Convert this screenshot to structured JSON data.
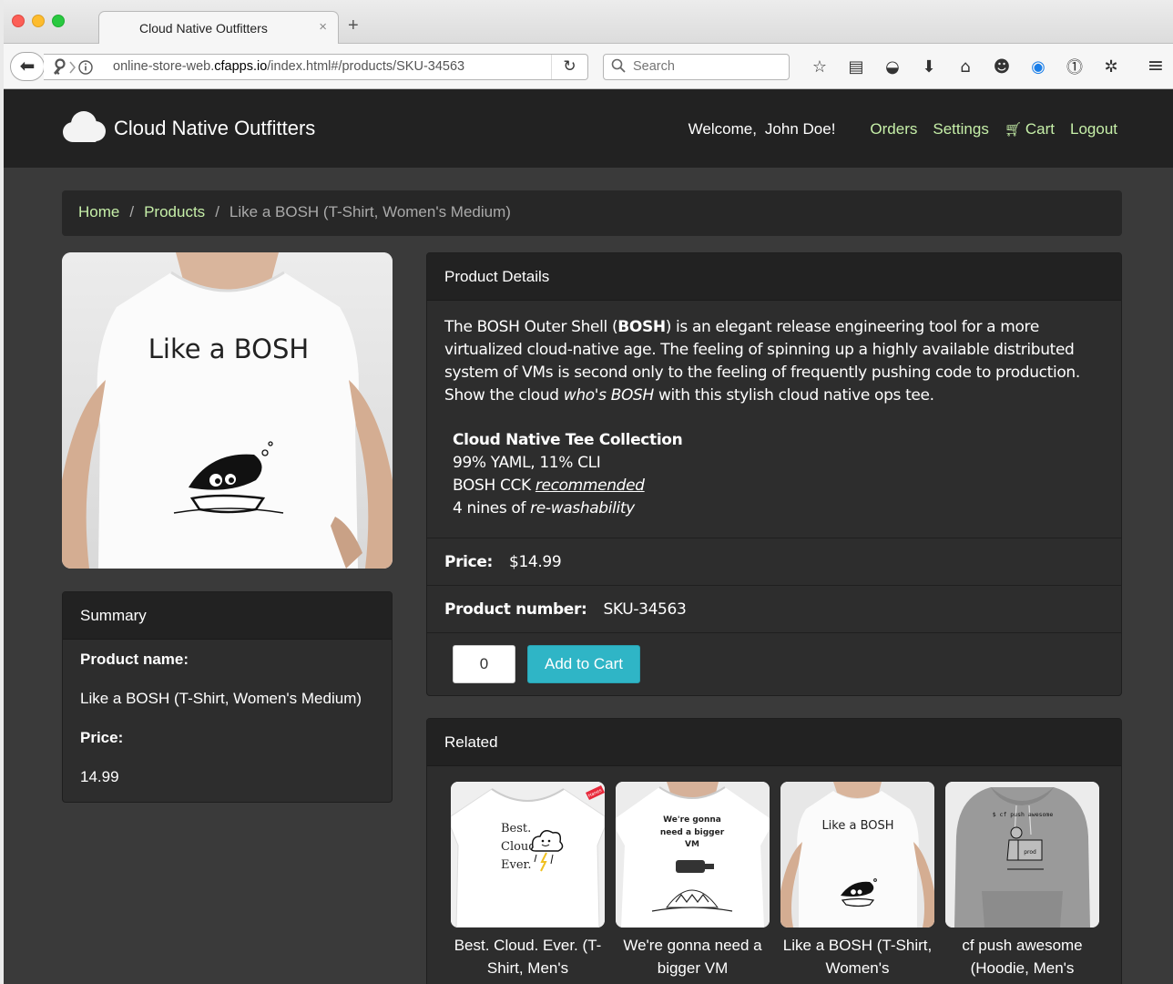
{
  "browser": {
    "tab_title": "Cloud Native Outfitters",
    "tab_close": "×",
    "new_tab": "+",
    "url_prefix": "online-store-web.",
    "url_domain": "cfapps.io",
    "url_path": "/index.html#/products/SKU-34563",
    "search_placeholder": "Search"
  },
  "site": {
    "brand": "Cloud Native Outfitters",
    "welcome_label": "Welcome,",
    "user_name": "John Doe!",
    "nav": {
      "orders": "Orders",
      "settings": "Settings",
      "cart": "Cart",
      "logout": "Logout"
    },
    "accent_color": "#c6efa8"
  },
  "breadcrumb": {
    "home": "Home",
    "products": "Products",
    "current": "Like a BOSH (T-Shirt, Women's Medium)",
    "separator": "/"
  },
  "product_image": {
    "shirt_text": "Like a BOSH"
  },
  "summary": {
    "heading": "Summary",
    "name_label": "Product name:",
    "name_value": "Like a BOSH (T-Shirt, Women's Medium)",
    "price_label": "Price:",
    "price_value": "14.99"
  },
  "details": {
    "heading": "Product Details",
    "desc_1": "The BOSH Outer Shell (",
    "desc_bold": "BOSH",
    "desc_2": ") is an elegant release engineering tool for a more virtualized cloud-native age. The feeling of spinning up a highly available distributed system of VMs is second only to the feeling of frequently pushing code to production. Show the cloud ",
    "desc_italic": "who's BOSH",
    "desc_3": " with this stylish cloud native ops tee.",
    "collection_title": "Cloud Native Tee Collection",
    "collection_line_1": "99% YAML, 11% CLI",
    "collection_line_2_a": "BOSH CCK ",
    "collection_line_2_b": "recommended",
    "collection_line_3_a": "4 nines of ",
    "collection_line_3_b": "re-washability",
    "price_label": "Price:",
    "price_value": "$14.99",
    "number_label": "Product number:",
    "number_value": "SKU-34563",
    "quantity": "0",
    "add_to_cart": "Add to Cart",
    "button_color": "#2fb5c6"
  },
  "related": {
    "heading": "Related",
    "items": [
      {
        "name": "Best. Cloud. Ever. (T-Shirt, Men's",
        "shirt_text": [
          "Best.",
          "Cloud.",
          "Ever."
        ],
        "tag": "Hanes"
      },
      {
        "name": "We're gonna need a bigger VM",
        "shirt_text": [
          "We're gonna",
          "need a bigger",
          "VM"
        ]
      },
      {
        "name": "Like a BOSH (T-Shirt, Women's",
        "shirt_text": [
          "Like a BOSH"
        ]
      },
      {
        "name": "cf push awesome (Hoodie, Men's",
        "shirt_text": [
          "$ cf push awesome",
          "prod"
        ]
      }
    ]
  }
}
